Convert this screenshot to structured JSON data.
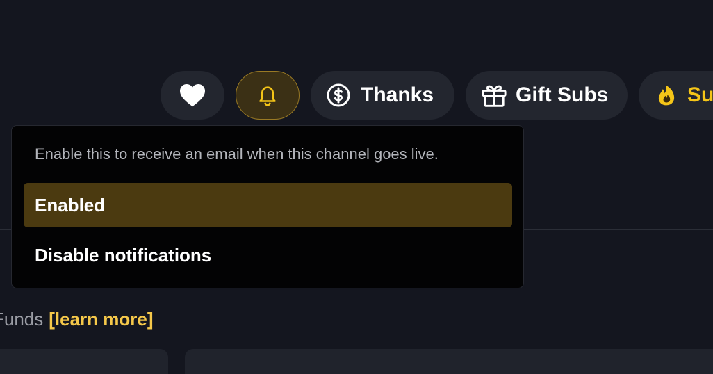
{
  "actions": {
    "like_icon": "heart-icon",
    "notify_icon": "bell-icon",
    "thanks": {
      "label": "Thanks",
      "icon": "dollar-circle-icon"
    },
    "gift_subs": {
      "label": "Gift Subs",
      "icon": "gift-icon"
    },
    "subscribe": {
      "label": "Su",
      "icon": "flame-icon"
    }
  },
  "notification_menu": {
    "description": "Enable this to receive an email when this channel goes live.",
    "options": [
      {
        "label": "Enabled",
        "selected": true
      },
      {
        "label": "Disable notifications",
        "selected": false
      }
    ]
  },
  "funds": {
    "text": "Funds",
    "link": "[learn more]"
  },
  "colors": {
    "background": "#14161f",
    "pill": "#23262f",
    "accent": "#f5c518",
    "selected_option": "#4b3a10"
  }
}
